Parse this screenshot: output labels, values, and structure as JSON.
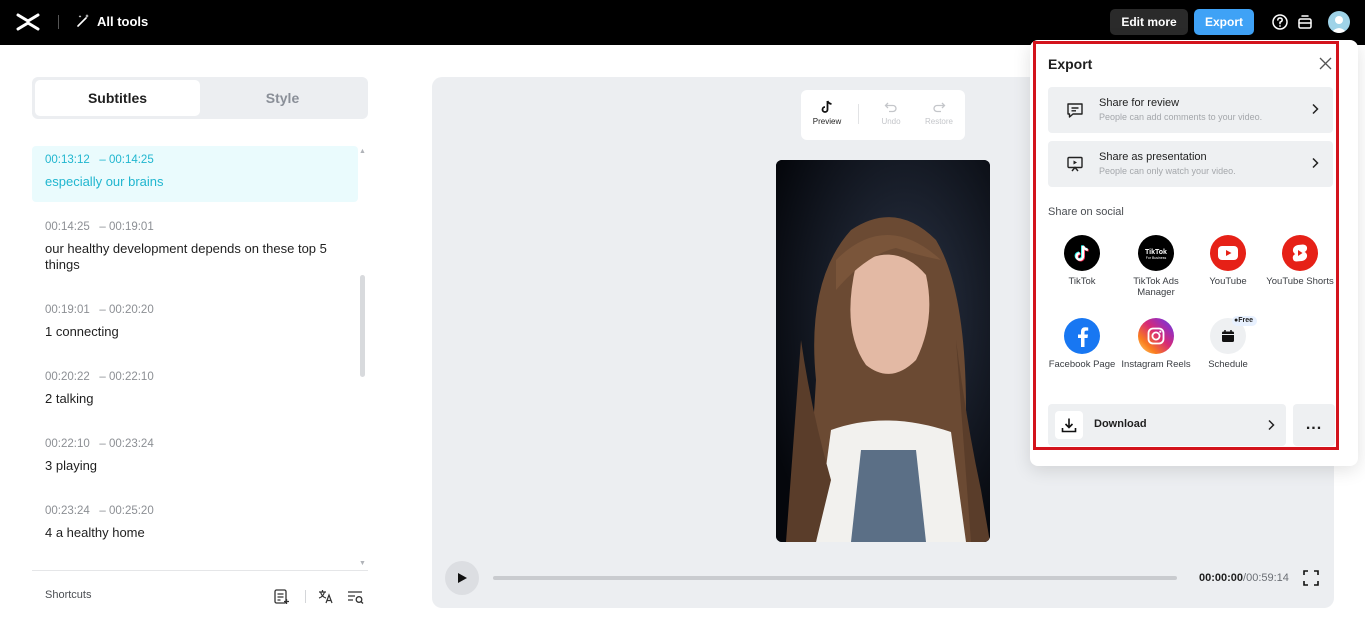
{
  "topbar": {
    "all_tools": "All tools",
    "edit_more": "Edit more",
    "export": "Export"
  },
  "left_panel": {
    "tabs": [
      {
        "label": "Subtitles",
        "active": true
      },
      {
        "label": "Style",
        "active": false
      }
    ],
    "subtitles": [
      {
        "start": "00:13:12",
        "end": "00:14:25",
        "text": "especially our brains",
        "active": true
      },
      {
        "start": "00:14:25",
        "end": "00:19:01",
        "text": "our healthy development depends on these top 5 things",
        "active": false
      },
      {
        "start": "00:19:01",
        "end": "00:20:20",
        "text": "1 connecting",
        "active": false
      },
      {
        "start": "00:20:22",
        "end": "00:22:10",
        "text": "2 talking",
        "active": false
      },
      {
        "start": "00:22:10",
        "end": "00:23:24",
        "text": "3 playing",
        "active": false
      },
      {
        "start": "00:23:24",
        "end": "00:25:20",
        "text": "4 a healthy home",
        "active": false
      }
    ],
    "shortcuts_label": "Shortcuts"
  },
  "preview": {
    "tools": {
      "preview": "Preview",
      "undo": "Undo",
      "restore": "Restore"
    },
    "current_time": "00:00:00",
    "total_time": "/00:59:14"
  },
  "export_panel": {
    "title": "Export",
    "share_review": {
      "title": "Share for review",
      "desc": "People can add comments to your video."
    },
    "share_presentation": {
      "title": "Share as presentation",
      "desc": "People can only watch your video."
    },
    "share_social_label": "Share on social",
    "social": [
      {
        "label": "TikTok",
        "color": "#000000"
      },
      {
        "label": "TikTok Ads Manager",
        "color": "#000000"
      },
      {
        "label": "YouTube",
        "color": "#e62117"
      },
      {
        "label": "YouTube Shorts",
        "color": "#e62117"
      },
      {
        "label": "Facebook Page",
        "color": "#1877f2"
      },
      {
        "label": "Instagram Reels",
        "color": "#d62976"
      },
      {
        "label": "Schedule",
        "color": "#eef0f2"
      }
    ],
    "free_badge": "Free",
    "download": "Download",
    "more": "..."
  },
  "colors": {
    "accent": "#3fa2f6",
    "subtitle_active": "#20b6cf",
    "highlight_border": "#d3131c"
  }
}
